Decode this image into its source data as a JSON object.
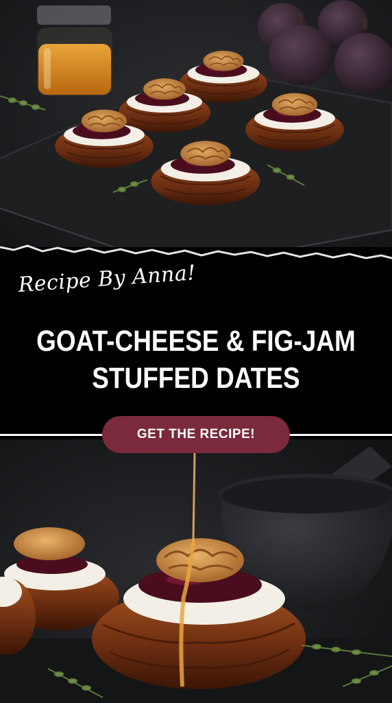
{
  "banner": {
    "script_title": "Recipe By Anna!",
    "headline_line1": "GOAT-CHEESE & FIG-JAM",
    "headline_line2": "STUFFED DATES"
  },
  "cta": {
    "label": "GET THE RECIPE!"
  },
  "colors": {
    "banner_background": "#000000",
    "button_background": "#7b2a3b",
    "text": "#ffffff",
    "date_brown": "#6b2e12",
    "fig_jam": "#4a0d1e",
    "goat_cheese": "#f3efe6",
    "walnut": "#c98a45",
    "slate": "#1e1f21"
  },
  "images": {
    "top_photo": "stuffed dates on slate board with honey jar and figs",
    "bottom_photo": "close-up stuffed date drizzled with honey beside mortar and pestle"
  }
}
